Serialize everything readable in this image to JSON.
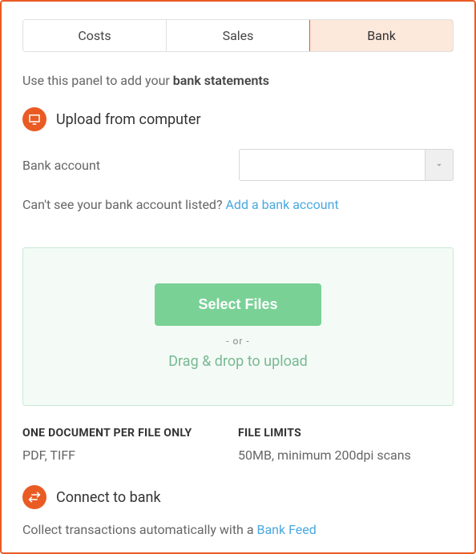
{
  "tabs": {
    "costs": "Costs",
    "sales": "Sales",
    "bank": "Bank"
  },
  "intro": {
    "prefix": "Use this panel to add your ",
    "bold": "bank statements"
  },
  "upload": {
    "title": "Upload from computer",
    "account_label": "Bank account",
    "account_value": "",
    "missing_prefix": "Can't see your bank account listed? ",
    "missing_link": "Add a bank account"
  },
  "dropzone": {
    "button": "Select Files",
    "or": "- or -",
    "drag": "Drag & drop to upload"
  },
  "limits": {
    "doc_title": "ONE DOCUMENT PER FILE ONLY",
    "doc_body": "PDF, TIFF",
    "file_title": "FILE LIMITS",
    "file_body": "50MB, minimum 200dpi scans"
  },
  "connect": {
    "title": "Connect to bank",
    "body_prefix": "Collect transactions automatically with a ",
    "body_link": "Bank Feed"
  }
}
